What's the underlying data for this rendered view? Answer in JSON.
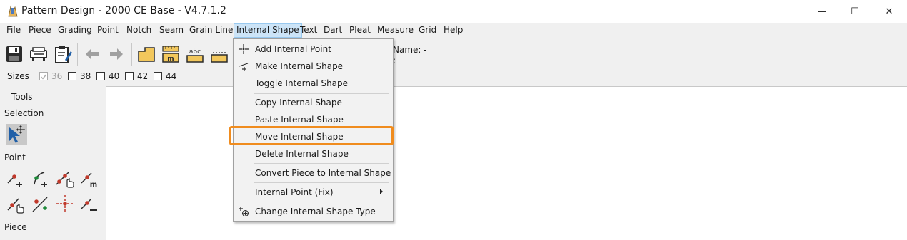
{
  "window": {
    "title": "Pattern Design - 2000 CE Base - V4.7.1.2",
    "minimize_glyph": "—",
    "maximize_glyph": "☐",
    "close_glyph": "✕"
  },
  "menubar": {
    "items": [
      "File",
      "Piece",
      "Grading",
      "Point",
      "Notch",
      "Seam",
      "Grain Line",
      "Internal Shape",
      "Text",
      "Dart",
      "Pleat",
      "Measure",
      "Grid",
      "Help"
    ],
    "active": "Internal Shape"
  },
  "toolbar": {
    "buttons": [
      "save-icon",
      "plotter-icon",
      "clipboard-edit-icon",
      "undo-icon",
      "redo-icon",
      "piece-icon",
      "ruler-piece-icon",
      "text-abc-icon",
      "dotted-piece-icon"
    ],
    "text_label": "abc",
    "ruler_label": "m"
  },
  "info": {
    "name": "Name: -",
    "line2": ": -"
  },
  "sizes": {
    "label": "Sizes",
    "items": [
      {
        "value": "36",
        "checked": true,
        "disabled": true
      },
      {
        "value": "38",
        "checked": false,
        "disabled": false
      },
      {
        "value": "40",
        "checked": false,
        "disabled": false
      },
      {
        "value": "42",
        "checked": false,
        "disabled": false
      },
      {
        "value": "44",
        "checked": false,
        "disabled": false
      }
    ]
  },
  "left_panel": {
    "tools_label": "Tools",
    "selection_label": "Selection",
    "point_label": "Point",
    "piece_label": "Piece",
    "tool_m_label": "m"
  },
  "dropdown": {
    "items": [
      "Add Internal Point",
      "Make Internal Shape",
      "Toggle Internal Shape",
      "Copy Internal Shape",
      "Paste Internal Shape",
      "Move Internal Shape",
      "Delete Internal Shape",
      "Convert Piece to Internal Shape",
      "Internal Point (Fix)",
      "Change Internal Shape Type"
    ],
    "highlighted": "Move Internal Shape",
    "submenu_item": "Internal Point (Fix)"
  },
  "colors": {
    "highlight_outline": "#f08c1e",
    "menu_active_bg": "#cce4f7",
    "canvas_bg": "#ffffff",
    "selection_tool_bg": "#c8c8c8",
    "tool_point_red": "#c0392b",
    "tool_point_green": "#1e8a3a",
    "icon_blue": "#1f5fa8"
  }
}
